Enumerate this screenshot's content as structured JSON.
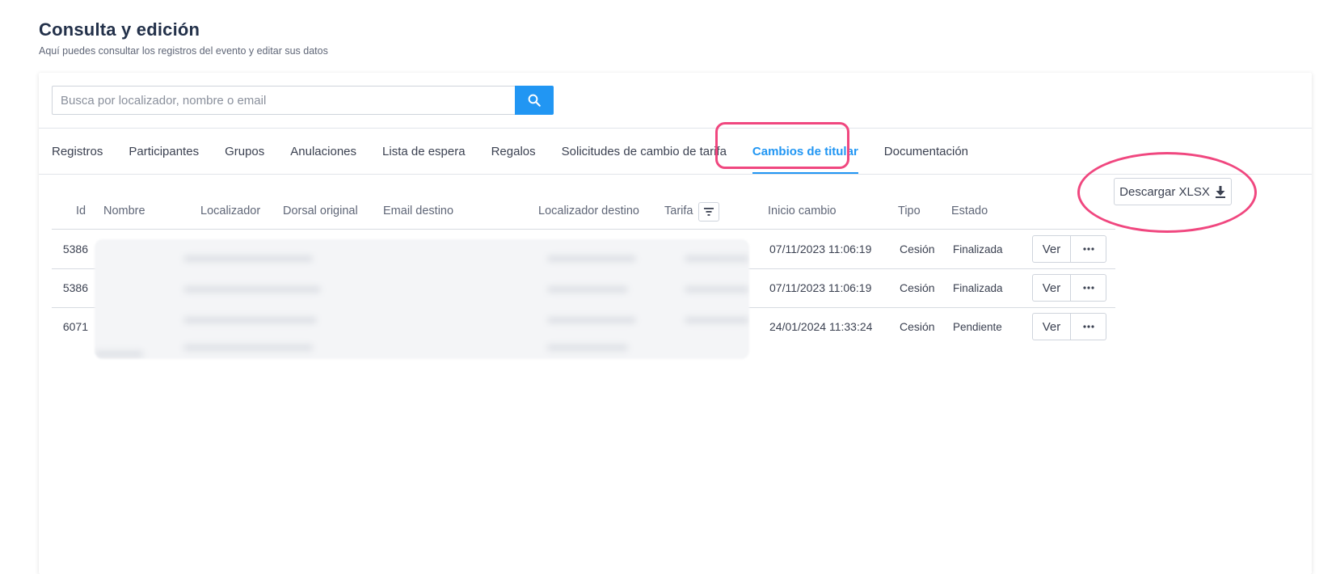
{
  "page": {
    "title": "Consulta y edición",
    "subtitle": "Aquí puedes consultar los registros del evento y editar sus datos"
  },
  "search": {
    "placeholder": "Busca por localizador, nombre o email",
    "value": "",
    "button_icon": "search-icon"
  },
  "tabs": [
    {
      "label": "Registros",
      "active": false
    },
    {
      "label": "Participantes",
      "active": false
    },
    {
      "label": "Grupos",
      "active": false
    },
    {
      "label": "Anulaciones",
      "active": false
    },
    {
      "label": "Lista de espera",
      "active": false
    },
    {
      "label": "Regalos",
      "active": false
    },
    {
      "label": "Solicitudes de cambio de tarifa",
      "active": false
    },
    {
      "label": "Cambios de titular",
      "active": true
    },
    {
      "label": "Documentación",
      "active": false
    }
  ],
  "toolbar": {
    "download_label": "Descargar XLSX",
    "download_icon": "download-icon"
  },
  "table": {
    "columns": [
      "Id",
      "Nombre",
      "Localizador",
      "Dorsal original",
      "Email destino",
      "Localizador destino",
      "Tarifa",
      "Inicio cambio",
      "Tipo",
      "Estado"
    ],
    "rows": [
      {
        "id": "5386",
        "inicio_cambio": "07/11/2023 11:06:19",
        "tipo": "Cesión",
        "estado": "Finalizada"
      },
      {
        "id": "5386",
        "inicio_cambio": "07/11/2023 11:06:19",
        "tipo": "Cesión",
        "estado": "Finalizada"
      },
      {
        "id": "6071",
        "inicio_cambio": "24/01/2024 11:33:24",
        "tipo": "Cesión",
        "estado": "Pendiente"
      }
    ],
    "row_action_label": "Ver"
  },
  "colors": {
    "accent": "#2196f3",
    "highlight": "#f0477f",
    "title": "#23314a"
  }
}
